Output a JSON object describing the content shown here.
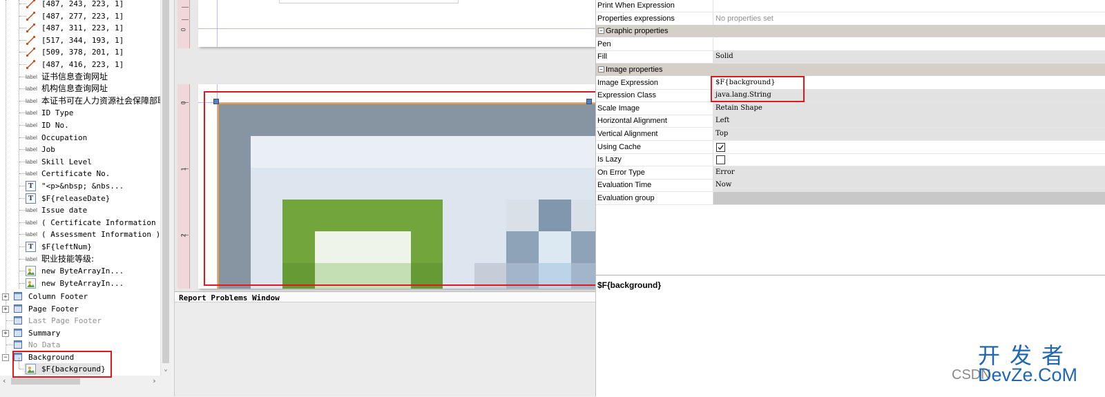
{
  "tree": {
    "lines": [
      {
        "text": "[487, 243, 223, 1]",
        "icon": "line-icon"
      },
      {
        "text": "[487, 277, 223, 1]",
        "icon": "line-icon"
      },
      {
        "text": "[487, 311, 223, 1]",
        "icon": "line-icon"
      },
      {
        "text": "[517, 344, 193, 1]",
        "icon": "line-icon"
      },
      {
        "text": "[509, 378, 201, 1]",
        "icon": "line-icon"
      },
      {
        "text": "[487, 416, 223, 1]",
        "icon": "line-icon"
      }
    ],
    "items": [
      {
        "text": "证书信息查询网址",
        "icon": "label-icon",
        "cjk": true
      },
      {
        "text": "机构信息查询网址",
        "icon": "label-icon",
        "cjk": true
      },
      {
        "text": "本证书可在人力资源社会保障部职",
        "icon": "label-icon",
        "cjk": true
      },
      {
        "text": "ID Type",
        "icon": "label-icon"
      },
      {
        "text": "ID No.",
        "icon": "label-icon"
      },
      {
        "text": "Occupation",
        "icon": "label-icon"
      },
      {
        "text": "Job",
        "icon": "label-icon"
      },
      {
        "text": "Skill Level",
        "icon": "label-icon"
      },
      {
        "text": "Certificate No.",
        "icon": "label-icon"
      },
      {
        "text": "\"<p>&nbsp; &nbs...",
        "icon": "textfield-icon"
      },
      {
        "text": "$F{releaseDate}",
        "icon": "textfield-icon"
      },
      {
        "text": "Issue date",
        "icon": "label-icon"
      },
      {
        "text": "( Certificate Information ):",
        "icon": "label-icon"
      },
      {
        "text": "( Assessment Information ): h",
        "icon": "label-icon"
      },
      {
        "text": "$F{leftNum}",
        "icon": "textfield-icon"
      },
      {
        "text": "职业技能等级:",
        "icon": "label-icon",
        "cjk": true
      },
      {
        "text": "new ByteArrayIn...",
        "icon": "image-icon"
      },
      {
        "text": "new ByteArrayIn...",
        "icon": "image-icon"
      }
    ],
    "icon_label_text": "label",
    "icon_text_glyph": "T",
    "bands": [
      {
        "text": "Column Footer",
        "muted": false,
        "expander": "+"
      },
      {
        "text": "Page Footer",
        "muted": false,
        "expander": "+"
      },
      {
        "text": "Last Page Footer",
        "muted": true,
        "expander": ""
      },
      {
        "text": "Summary",
        "muted": false,
        "expander": "+"
      },
      {
        "text": "No Data",
        "muted": true,
        "expander": ""
      },
      {
        "text": "Background",
        "muted": false,
        "expander": "−"
      }
    ],
    "background_child": "$F{background}"
  },
  "designer": {
    "ruler_top_label": "0",
    "ruler_labels": [
      "0",
      "1",
      "2"
    ],
    "problems_title": "Report Problems Window",
    "colors": {
      "accent_green": "#72a53b",
      "slate": "#8795a3",
      "red_highlight": "#e0181c",
      "selection_orange": "#f0a020"
    }
  },
  "props": {
    "top_rows": [
      {
        "name": "Print When Expression",
        "value": "",
        "style": "plain"
      },
      {
        "name": "Properties expressions",
        "value": "No properties set",
        "style": "gray"
      }
    ],
    "graphic_header": "Graphic properties",
    "graphic_rows": [
      {
        "name": "Pen",
        "value": "",
        "style": "plain"
      },
      {
        "name": "Fill",
        "value": "Solid",
        "style": "combo"
      }
    ],
    "image_header": "Image properties",
    "image_rows": [
      {
        "name": "Image Expression",
        "value": "$F{background}",
        "style": "plain"
      },
      {
        "name": "Expression Class",
        "value": "java.lang.String",
        "style": "combo"
      },
      {
        "name": "Scale Image",
        "value": "Retain Shape",
        "style": "combo"
      },
      {
        "name": "Horizontal Alignment",
        "value": "Left",
        "style": "combo"
      },
      {
        "name": "Vertical Alignment",
        "value": "Top",
        "style": "combo"
      },
      {
        "name": "Using Cache",
        "value": "",
        "style": "check-on"
      },
      {
        "name": "Is Lazy",
        "value": "",
        "style": "check-off"
      },
      {
        "name": "On Error Type",
        "value": "Error",
        "style": "combo"
      },
      {
        "name": "Evaluation Time",
        "value": "Now",
        "style": "combo"
      },
      {
        "name": "Evaluation group",
        "value": "",
        "style": "dark"
      }
    ],
    "description_title": "$F{background}"
  },
  "watermark": {
    "cn": "开发者",
    "csdn": "CSDN",
    "en": "DevZe.CoM"
  }
}
